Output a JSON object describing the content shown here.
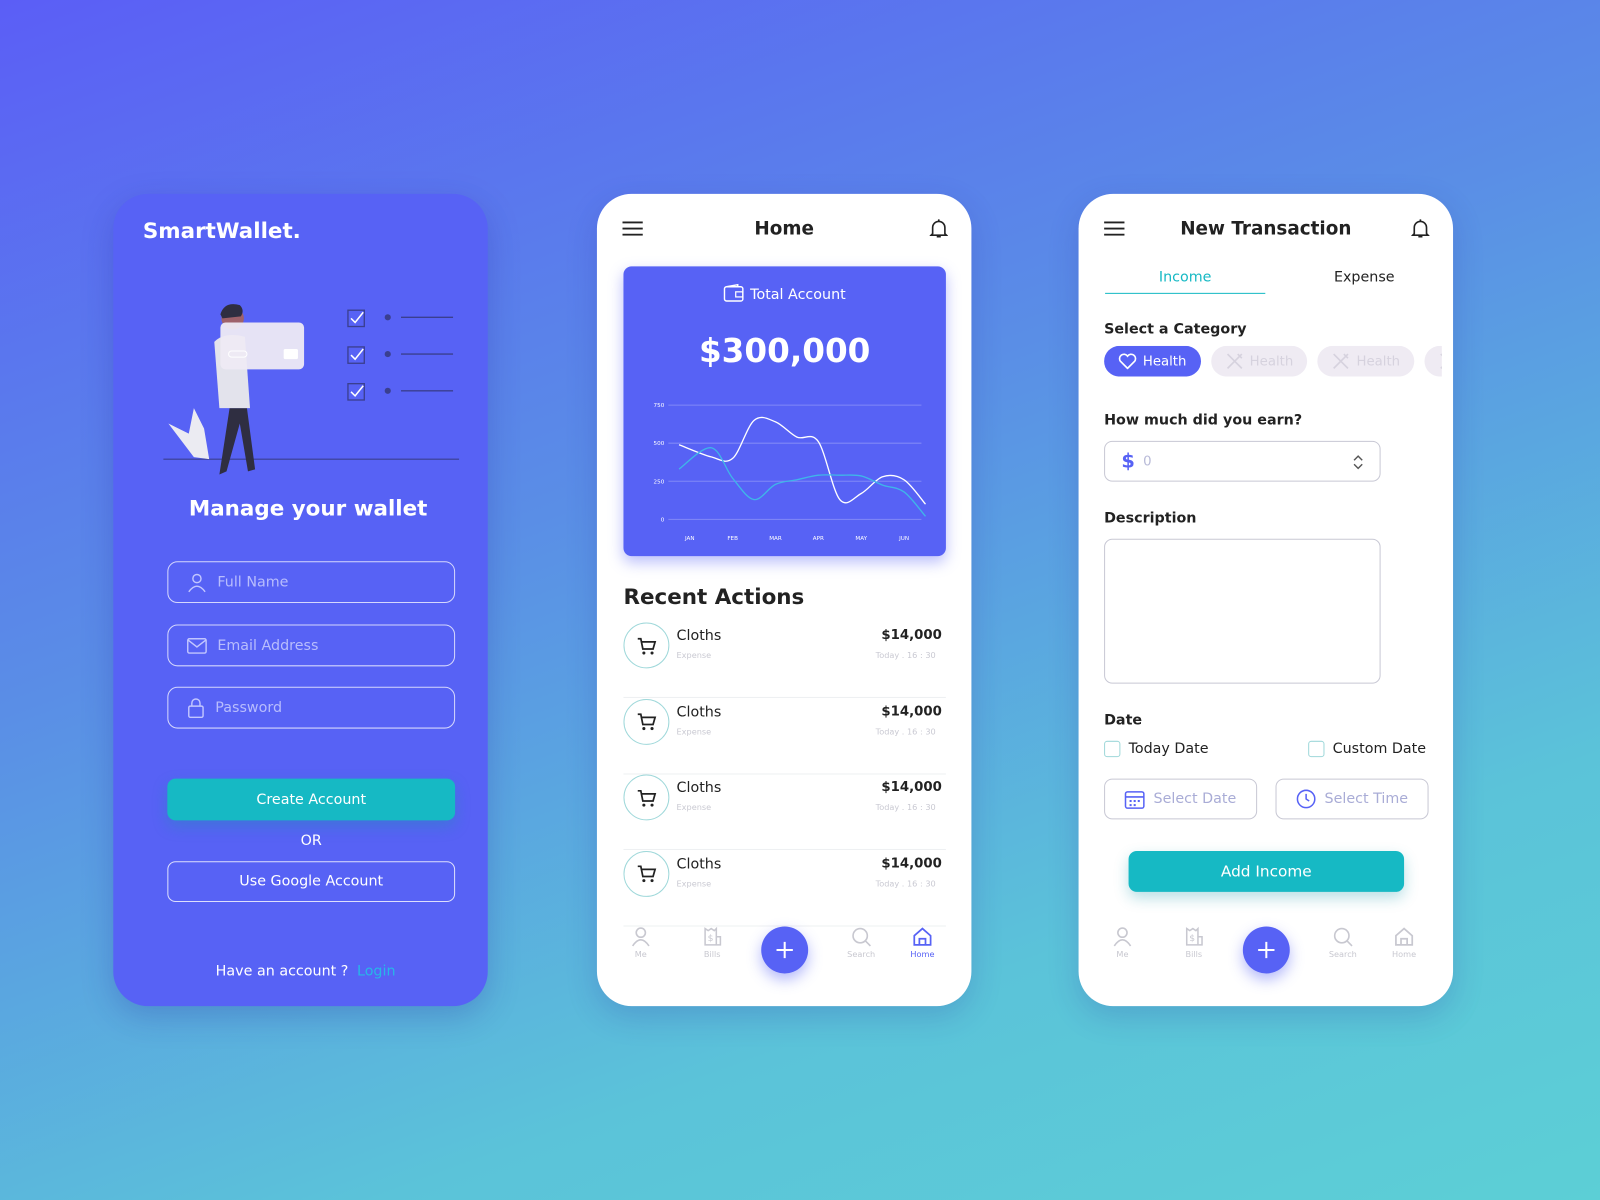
{
  "colors": {
    "primary": "#5762f5",
    "accent": "#16b9c4",
    "background_top": "#5b5ef6",
    "background_bottom": "#5ccfd6"
  },
  "signup": {
    "logo": "SmartWallet.",
    "heading": "Manage your wallet",
    "fields": [
      {
        "placeholder": "Full Name",
        "icon": "user-icon"
      },
      {
        "placeholder": "Email Address",
        "icon": "mail-icon"
      },
      {
        "placeholder": "Password",
        "icon": "lock-icon"
      }
    ],
    "create_button": "Create Account",
    "or_label": "OR",
    "google_button": "Use Google Account",
    "have_account": "Have an account ?",
    "login_link": "Login"
  },
  "home": {
    "title": "Home",
    "total_label": "Total Account",
    "total_value": "$300,000",
    "recent_title": "Recent Actions",
    "transactions": [
      {
        "name": "Cloths",
        "type": "Expense",
        "amount": "$14,000",
        "time": "Today . 16 : 30",
        "icon": "cart-icon"
      },
      {
        "name": "Cloths",
        "type": "Expense",
        "amount": "$14,000",
        "time": "Today . 16 : 30",
        "icon": "cart-icon"
      },
      {
        "name": "Cloths",
        "type": "Expense",
        "amount": "$14,000",
        "time": "Today . 16 : 30",
        "icon": "cart-icon"
      },
      {
        "name": "Cloths",
        "type": "Expense",
        "amount": "$14,000",
        "time": "Today . 16 : 30",
        "icon": "cart-icon"
      }
    ],
    "nav": [
      {
        "label": "Me"
      },
      {
        "label": "Bills"
      },
      {
        "label": "Search"
      },
      {
        "label": "Home",
        "active": true
      }
    ]
  },
  "chart_data": {
    "type": "line",
    "categories": [
      "JAN",
      "FEB",
      "MAR",
      "APR",
      "MAY",
      "JUN"
    ],
    "yticks": [
      "0",
      "250",
      "500",
      "750"
    ],
    "ylim": [
      0,
      750
    ],
    "grid": true,
    "x": [
      -0.25,
      0.5,
      1,
      1.5,
      2,
      2.5,
      3,
      3.5,
      4,
      4.5,
      5,
      5.5
    ],
    "series": [
      {
        "color": "#ffffff",
        "values": [
          490,
          410,
          400,
          650,
          640,
          540,
          510,
          130,
          170,
          280,
          260,
          100
        ]
      },
      {
        "color": "#3fb6e8",
        "values": [
          330,
          470,
          270,
          130,
          230,
          260,
          290,
          290,
          285,
          225,
          180,
          20
        ]
      }
    ]
  },
  "transaction": {
    "title": "New Transaction",
    "tabs": [
      {
        "label": "Income",
        "active": true
      },
      {
        "label": "Expense"
      }
    ],
    "category_label": "Select a Category",
    "categories": [
      {
        "label": "Health",
        "icon": "heart-icon",
        "selected": true
      },
      {
        "label": "Health",
        "icon": "cutlery-icon"
      },
      {
        "label": "Health",
        "icon": "cutlery-icon"
      },
      {
        "label": "",
        "icon": "cutlery-icon"
      }
    ],
    "amount_label": "How much did you earn?",
    "amount_currency": "$",
    "amount_value": "0",
    "description_label": "Description",
    "date_label": "Date",
    "today_date": "Today Date",
    "custom_date": "Custom Date",
    "select_date": "Select Date",
    "select_time": "Select Time",
    "submit": "Add Income",
    "nav": [
      {
        "label": "Me"
      },
      {
        "label": "Bills"
      },
      {
        "label": "Search"
      },
      {
        "label": "Home"
      }
    ]
  }
}
